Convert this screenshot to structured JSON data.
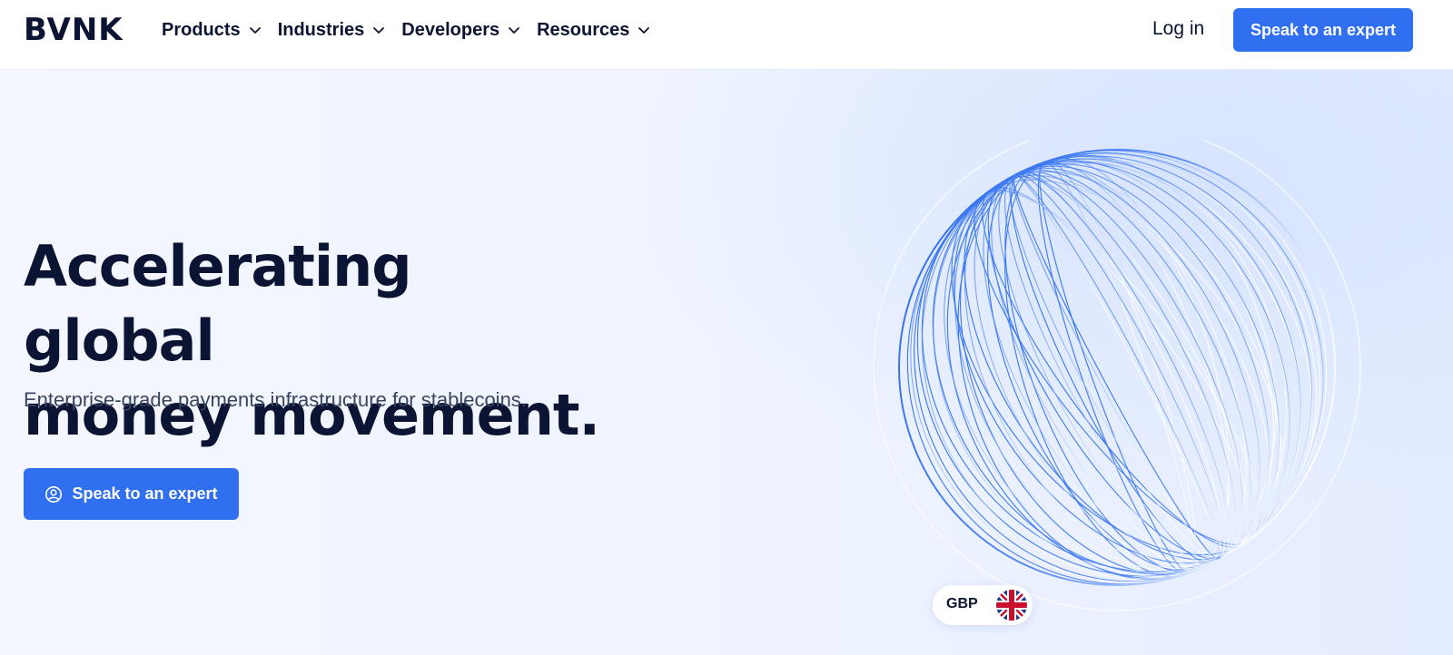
{
  "brand": {
    "logo_text": "BVNK"
  },
  "nav": {
    "items": [
      {
        "label": "Products"
      },
      {
        "label": "Industries"
      },
      {
        "label": "Developers"
      },
      {
        "label": "Resources"
      }
    ],
    "login_label": "Log in",
    "cta_label": "Speak to an expert"
  },
  "hero": {
    "title_line1": "Accelerating global",
    "title_line2": "money movement.",
    "subtitle": "Enterprise-grade payments infrastructure for stablecoins.",
    "cta_label": "Speak to an expert",
    "cta_icon": "user-circle-icon"
  },
  "currency_badge": {
    "code": "GBP",
    "flag_icon": "uk-flag-icon"
  },
  "colors": {
    "accent": "#2f6ff0",
    "text_dark": "#0b1433",
    "text_muted": "#3a4560",
    "hero_bg": "#eef3ff"
  }
}
